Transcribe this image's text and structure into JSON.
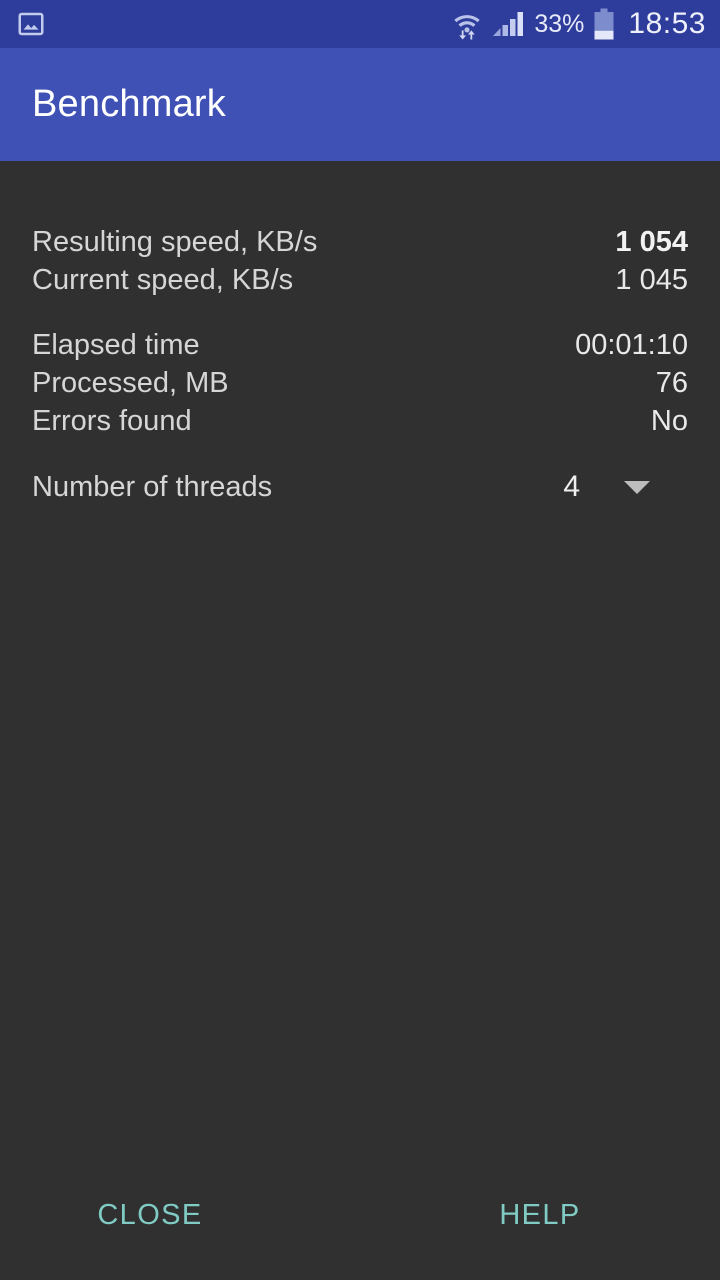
{
  "status_bar": {
    "notification_icon": "photo-icon",
    "wifi_icon": "wifi-transfer-icon",
    "signal_icon": "cellular-signal-icon",
    "battery_icon": "battery-icon",
    "battery_percent": "33%",
    "time": "18:53",
    "background_color": "#2E3C9B"
  },
  "app_bar": {
    "title": "Benchmark",
    "background_color": "#3F51B5",
    "text_color": "#FFFFFF"
  },
  "content": {
    "background_color": "#303030",
    "speed_group": [
      {
        "label": "Resulting speed, KB/s",
        "value": "1 054",
        "bold": true
      },
      {
        "label": "Current speed, KB/s",
        "value": "1 045",
        "bold": false
      }
    ],
    "progress_group": [
      {
        "label": "Elapsed time",
        "value": "00:01:10"
      },
      {
        "label": "Processed, MB",
        "value": "76"
      },
      {
        "label": "Errors found",
        "value": "No"
      }
    ],
    "threads": {
      "label": "Number of threads",
      "value": "4",
      "caret_icon": "chevron-down-icon"
    }
  },
  "buttons": {
    "close_label": "CLOSE",
    "help_label": "HELP",
    "accent_color": "#80CBC4"
  }
}
